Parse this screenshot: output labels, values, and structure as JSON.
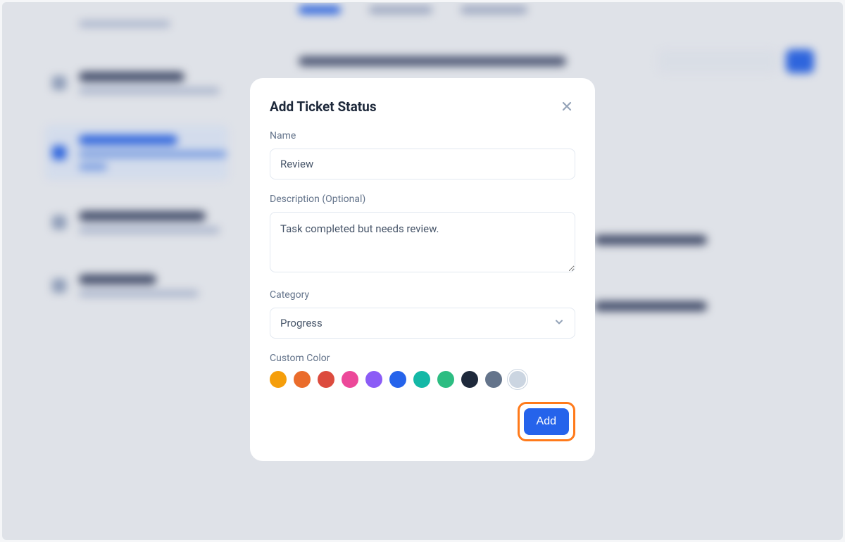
{
  "modal": {
    "title": "Add Ticket Status",
    "name_label": "Name",
    "name_value": "Review",
    "description_label": "Description (Optional)",
    "description_value": "Task completed but needs review.",
    "category_label": "Category",
    "category_value": "Progress",
    "custom_color_label": "Custom Color",
    "colors": [
      {
        "hex": "#f59e0b",
        "selected": false
      },
      {
        "hex": "#ea6c2b",
        "selected": false
      },
      {
        "hex": "#dc4b3e",
        "selected": false
      },
      {
        "hex": "#ec4899",
        "selected": false
      },
      {
        "hex": "#8b5cf6",
        "selected": false
      },
      {
        "hex": "#2563eb",
        "selected": false
      },
      {
        "hex": "#14b8a6",
        "selected": false
      },
      {
        "hex": "#2dbd82",
        "selected": false
      },
      {
        "hex": "#1e293b",
        "selected": false
      },
      {
        "hex": "#64748b",
        "selected": false
      },
      {
        "hex": "#cbd5e1",
        "selected": true
      }
    ],
    "add_button_label": "Add"
  }
}
